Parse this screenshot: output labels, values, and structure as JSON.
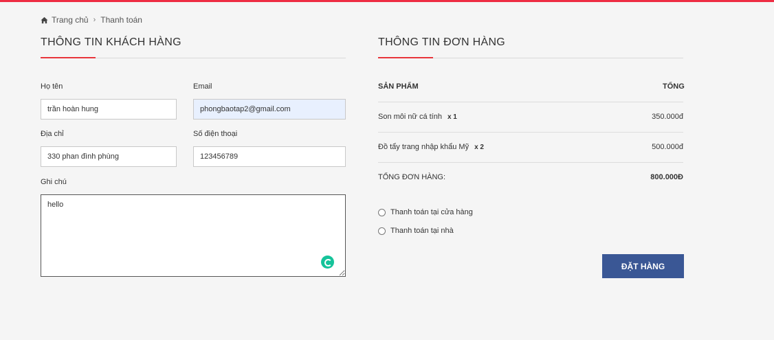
{
  "breadcrumb": {
    "home": "Trang chủ",
    "current": "Thanh toán"
  },
  "customer": {
    "title": "THÔNG TIN KHÁCH HÀNG",
    "fields": {
      "name": {
        "label": "Họ tên",
        "value": "trần hoàn hung"
      },
      "email": {
        "label": "Email",
        "value": "phongbaotap2@gmail.com"
      },
      "address": {
        "label": "Địa chỉ",
        "value": "330 phan đình phùng"
      },
      "phone": {
        "label": "Số điện thoại",
        "value": "123456789"
      },
      "note": {
        "label": "Ghi chú",
        "value": "hello"
      }
    }
  },
  "order": {
    "title": "THÔNG TIN ĐƠN HÀNG",
    "col_product": "SẢN PHẨM",
    "col_total": "TỔNG",
    "items": [
      {
        "name": "Son môi nữ cá tính",
        "qty": "x 1",
        "price": "350.000đ"
      },
      {
        "name": "Đồ tẩy trang nhập khẩu Mỹ",
        "qty": "x 2",
        "price": "500.000đ"
      }
    ],
    "total_label": "Tổng đơn hàng:",
    "total_value": "800.000Đ"
  },
  "payment": {
    "options": [
      "Thanh toán tại cửa hàng",
      "Thanh toán tại nhà"
    ]
  },
  "submit_label": "Đặt hàng",
  "colors": {
    "accent": "#e8353b",
    "button": "#3a5795",
    "top_bar": "#ee2d43"
  }
}
